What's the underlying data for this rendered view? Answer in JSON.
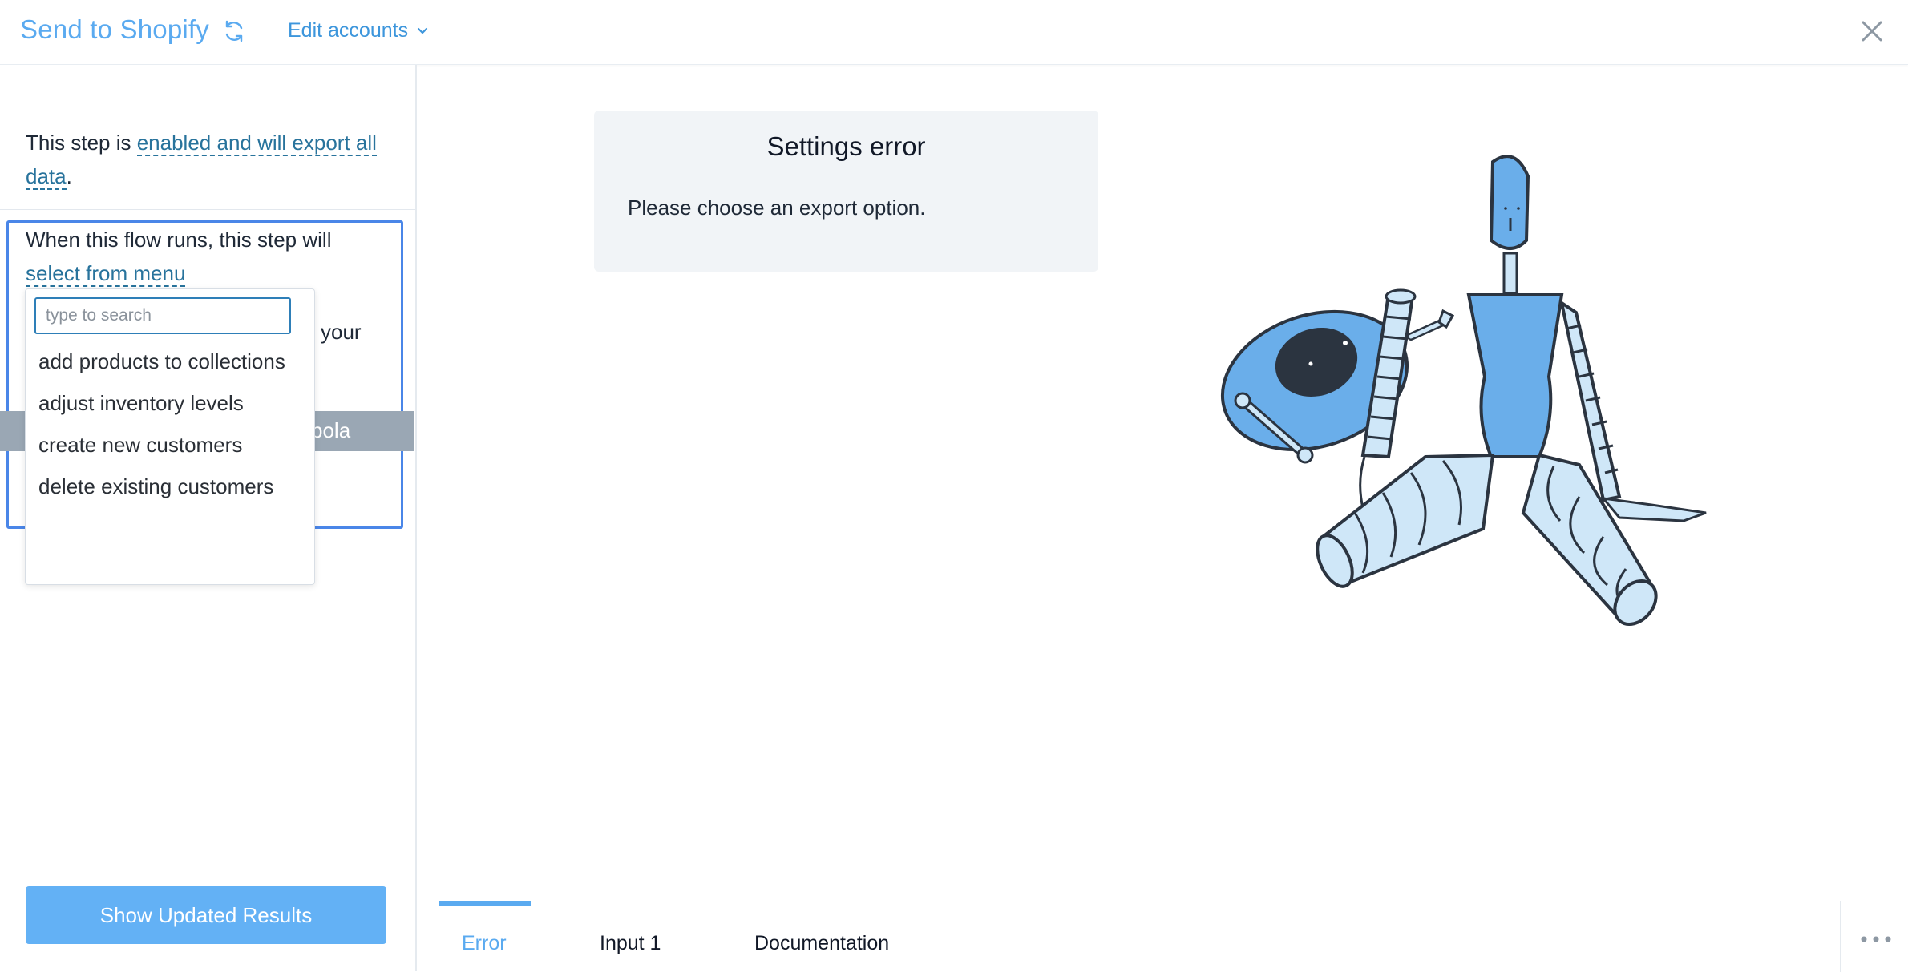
{
  "header": {
    "title": "Send to Shopify",
    "edit_accounts_label": "Edit accounts",
    "icons": [
      "refresh-icon",
      "chevron-down-icon",
      "close-icon"
    ]
  },
  "sidebar": {
    "status_prefix": "This step is ",
    "status_link": "enabled and will export all data",
    "status_suffix": ".",
    "flow_text": "When this flow runs, this step will",
    "flow_link": "select from menu",
    "partial_text": "your",
    "grey_bar_text": "pola",
    "show_results_label": "Show Updated Results"
  },
  "dropdown": {
    "search_placeholder": "type to search",
    "options": [
      "add products to collections",
      "adjust inventory levels",
      "create new customers",
      "delete existing customers"
    ]
  },
  "main": {
    "error_title": "Settings error",
    "error_message": "Please choose an export option."
  },
  "bottom_tabs": {
    "active": "Error",
    "items": [
      "Error",
      "Input 1",
      "Documentation"
    ],
    "more_icon": "more-horizontal-icon"
  },
  "colors": {
    "accent": "#5aaaf0",
    "link": "#28739c",
    "focus_border": "#4a86e8",
    "button": "#63b1f5",
    "error_card_bg": "#f1f4f7",
    "robot_fill": "#6aaeea",
    "robot_light": "#cfe7f8"
  }
}
